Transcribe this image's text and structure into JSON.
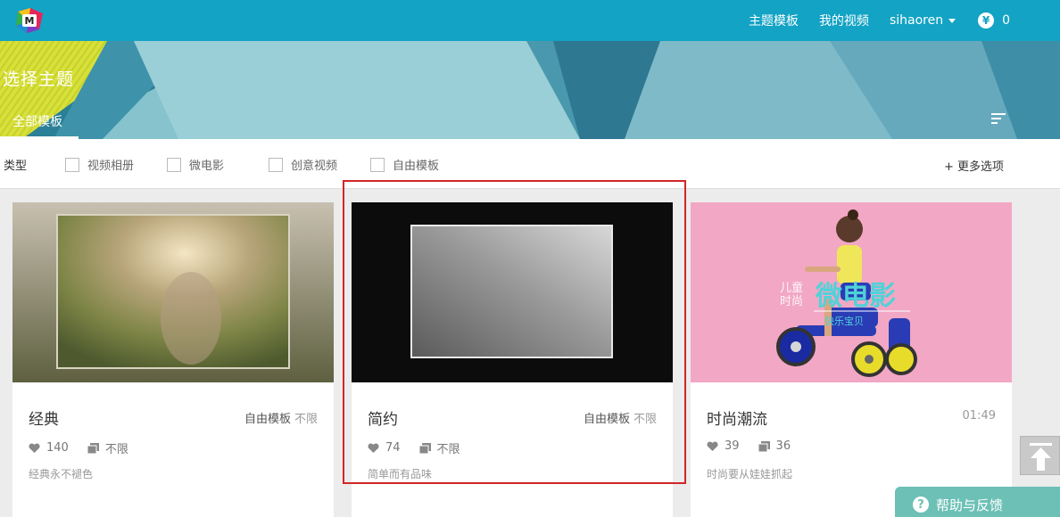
{
  "header": {
    "logo_letter": "M",
    "nav": [
      "主题模板",
      "我的视频"
    ],
    "username": "sihaoren",
    "coins": "0",
    "coin_symbol": "¥"
  },
  "banner": {
    "title": "选择主题",
    "tab": "全部模板"
  },
  "filter": {
    "label": "类型",
    "options": [
      "视频相册",
      "微电影",
      "创意视频",
      "自由模板"
    ],
    "more": "+ 更多选项"
  },
  "cards": [
    {
      "title": "经典",
      "meta_type": "自由模板",
      "meta_limit": "不限",
      "likes": "140",
      "count": "不限",
      "desc": "经典永不褪色"
    },
    {
      "title": "简约",
      "meta_type": "自由模板",
      "meta_limit": "不限",
      "likes": "74",
      "count": "不限",
      "desc": "简单而有品味"
    },
    {
      "title": "时尚潮流",
      "duration": "01:49",
      "likes": "39",
      "count": "36",
      "desc": "时尚要从娃娃抓起",
      "thumb_text": {
        "side": "儿童\n时尚",
        "main": "微电影",
        "sub": "快乐宝贝"
      }
    }
  ],
  "help": {
    "label": "帮助与反馈"
  },
  "colors": {
    "nav": "#13a3c4",
    "highlight": "#d12626",
    "help": "#6cc0b6"
  }
}
